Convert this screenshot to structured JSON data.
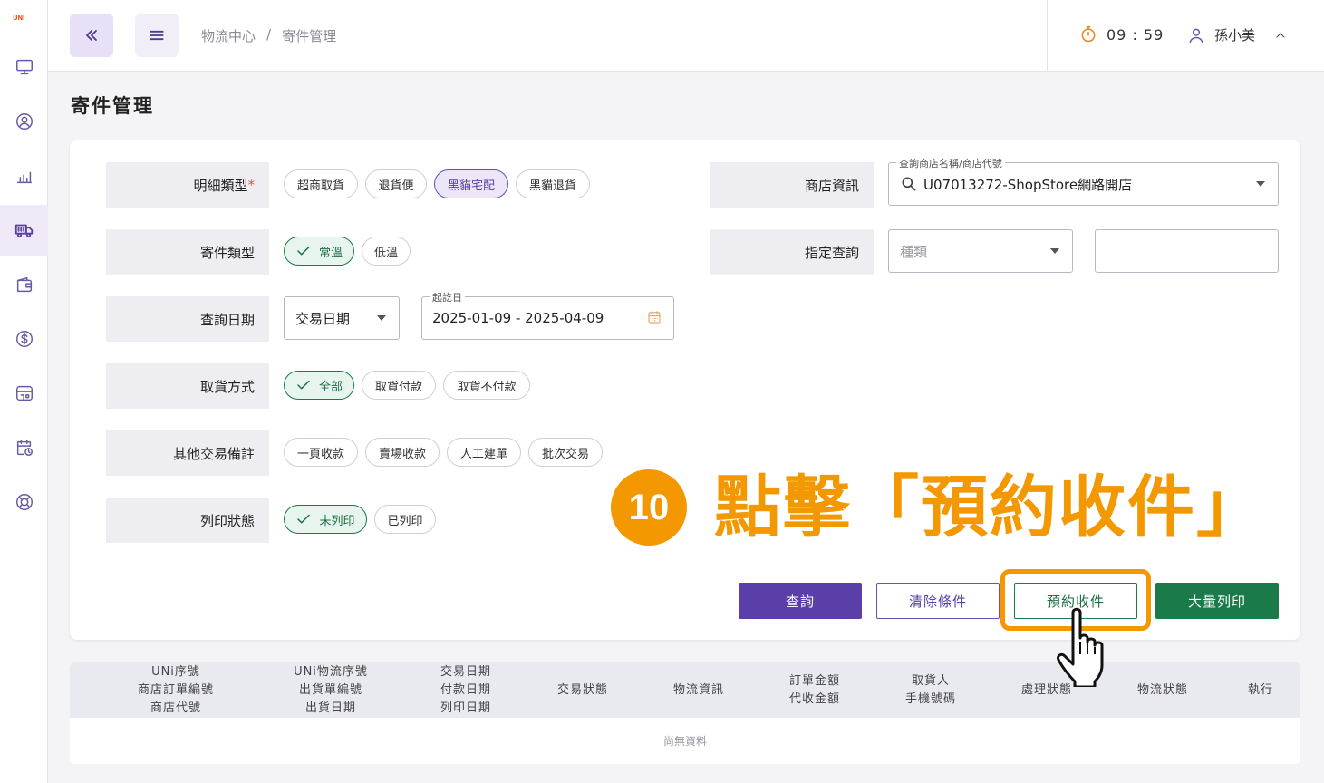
{
  "brand": {
    "logo_text": "UNI"
  },
  "sidebar": {
    "items": [
      {
        "icon": "monitor-icon"
      },
      {
        "icon": "user-circle-icon"
      },
      {
        "icon": "bar-chart-icon"
      },
      {
        "icon": "truck-icon",
        "active": true
      },
      {
        "icon": "wallet-icon"
      },
      {
        "icon": "dollar-icon"
      },
      {
        "icon": "store-icon"
      },
      {
        "icon": "calendar-clock-icon"
      },
      {
        "icon": "lifebuoy-icon"
      }
    ]
  },
  "header": {
    "breadcrumb": [
      "物流中心",
      "/",
      "寄件管理"
    ],
    "timer": "09 : 59",
    "user_name": "孫小美"
  },
  "page": {
    "title": "寄件管理"
  },
  "form": {
    "detail_type": {
      "label": "明細類型",
      "required_mark": "*",
      "options": [
        "超商取貨",
        "退貨便",
        "黑貓宅配",
        "黑貓退貨"
      ],
      "selected": "黑貓宅配"
    },
    "ship_type": {
      "label": "寄件類型",
      "options": [
        "常溫",
        "低溫"
      ],
      "selected": "常溫"
    },
    "query_date": {
      "label": "查詢日期",
      "date_type": "交易日期",
      "range_label": "起訖日",
      "range_value": "2025-01-09 - 2025-04-09"
    },
    "pickup_method": {
      "label": "取貨方式",
      "options": [
        "全部",
        "取貨付款",
        "取貨不付款"
      ],
      "selected": "全部"
    },
    "other_note": {
      "label": "其他交易備註",
      "options": [
        "一頁收款",
        "賣場收款",
        "人工建單",
        "批次交易"
      ]
    },
    "print_status": {
      "label": "列印狀態",
      "options": [
        "未列印",
        "已列印"
      ],
      "selected": "未列印"
    },
    "store_info": {
      "label": "商店資訊",
      "field_label": "查詢商店名稱/商店代號",
      "value": "U07013272-ShopStore網路開店"
    },
    "specific_query": {
      "label": "指定查詢",
      "type_placeholder": "種類",
      "value": ""
    }
  },
  "buttons": {
    "query": "查詢",
    "clear": "清除條件",
    "reserve": "預約收件",
    "print": "大量列印"
  },
  "annotation": {
    "step": "10",
    "text": "點擊「預約收件」",
    "color": "#f39800"
  },
  "table": {
    "columns": [
      [
        "UNi序號",
        "商店訂單編號",
        "商店代號"
      ],
      [
        "UNi物流序號",
        "出貨單編號",
        "出貨日期"
      ],
      [
        "交易日期",
        "付款日期",
        "列印日期"
      ],
      [
        "交易狀態"
      ],
      [
        "物流資訊"
      ],
      [
        "訂單金額",
        "代收金額"
      ],
      [
        "取貨人",
        "手機號碼"
      ],
      [
        "處理狀態"
      ],
      [
        "物流狀態"
      ],
      [
        "執行"
      ]
    ],
    "empty_text": "尚無資料"
  },
  "colors": {
    "primary": "#5a3fa8",
    "green": "#1b7a4a",
    "accent": "#f39800"
  }
}
